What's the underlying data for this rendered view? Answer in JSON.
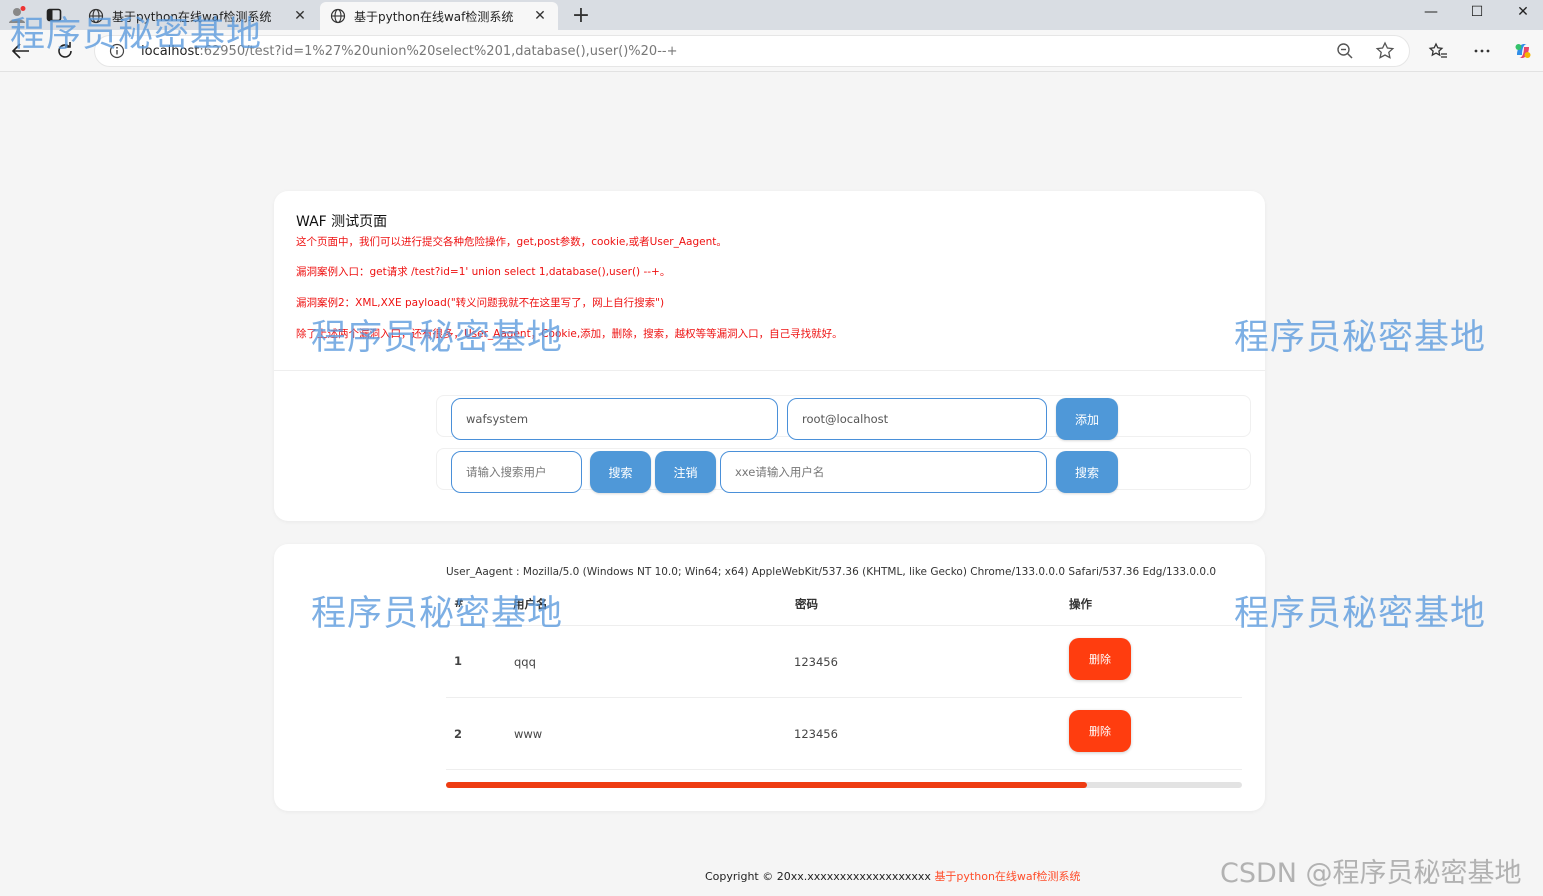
{
  "browser": {
    "tabs": [
      {
        "title": "基于python在线waf检测系统",
        "close": "✕"
      },
      {
        "title": "基于python在线waf检测系统",
        "close": "✕"
      }
    ],
    "new_tab": "+",
    "window": {
      "minimize": "—",
      "maximize": "☐",
      "close": "✕"
    },
    "url_host": "localhost",
    "url_rest": ":62950/test?id=1%27%20union%20select%201,database(),user()%20--+"
  },
  "watermark": "程序员秘密基地",
  "watermark_csdn": "CSDN @程序员秘密基地",
  "page": {
    "title": "WAF 测试页面",
    "notes": [
      "这个页面中，我们可以进行提交各种危险操作，get,post参数，cookie,或者User_Aagent。",
      "漏洞案例入口：get请求 /test?id=1' union select 1,database(),user() --+。",
      "漏洞案例2：XML,XXE payload(\"转义问题我就不在这里写了，网上自行搜索\")",
      "除了上述两个漏洞入口，还有很多，User_Aagent，Cookie,添加，删除，搜索，越权等等漏洞入口，自己寻找就好。"
    ],
    "form": {
      "username_value": "wafsystem",
      "password_value": "root@localhost",
      "add_label": "添加",
      "search_placeholder": "请输入搜索用户",
      "search_label": "搜索",
      "logout_label": "注销",
      "xxe_placeholder": "xxe请输入用户名",
      "xxe_search_label": "搜索"
    },
    "user_agent": "User_Aagent : Mozilla/5.0 (Windows NT 10.0; Win64; x64) AppleWebKit/537.36 (KHTML, like Gecko) Chrome/133.0.0.0 Safari/537.36 Edg/133.0.0.0",
    "table": {
      "headers": [
        "#",
        "用户名",
        "密码",
        "操作"
      ],
      "rows": [
        {
          "id": "1",
          "username": "qqq",
          "password": "123456",
          "action": "删除"
        },
        {
          "id": "2",
          "username": "www",
          "password": "123456",
          "action": "删除"
        }
      ]
    },
    "scroll_progress": 0.805,
    "footer_text": "Copyright © 20xx.xxxxxxxxxxxxxxxxxxx ",
    "footer_link": "基于python在线waf检测系统"
  }
}
